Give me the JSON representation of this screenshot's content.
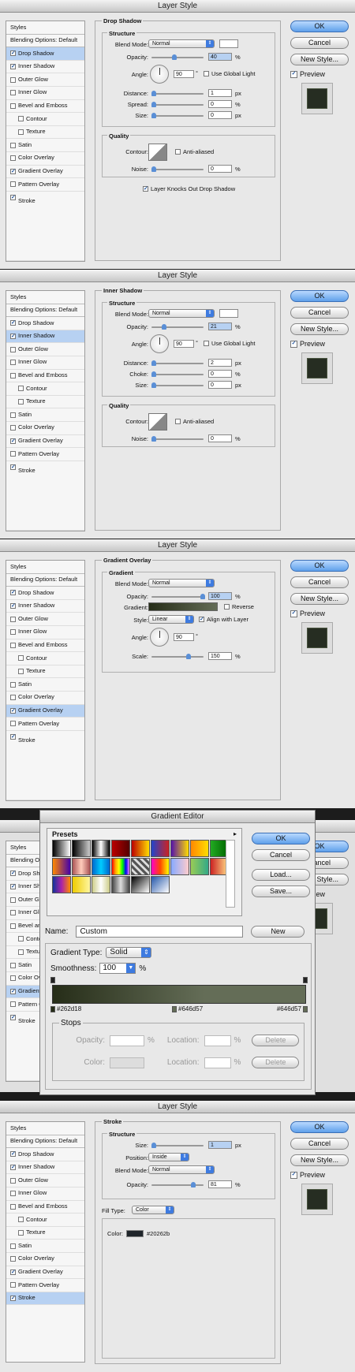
{
  "styles_list": [
    "Styles",
    "Blending Options: Default",
    "Drop Shadow",
    "Inner Shadow",
    "Outer Glow",
    "Inner Glow",
    "Bevel and Emboss",
    "Contour",
    "Texture",
    "Satin",
    "Color Overlay",
    "Gradient Overlay",
    "Pattern Overlay",
    "Stroke"
  ],
  "buttons": {
    "ok": "OK",
    "cancel": "Cancel",
    "new_style": "New Style...",
    "preview": "Preview"
  },
  "window_title": "Layer Style",
  "labels": {
    "blend_mode": "Blend Mode:",
    "opacity": "Opacity:",
    "angle": "Angle:",
    "use_global": "Use Global Light",
    "distance": "Distance:",
    "spread": "Spread:",
    "choke": "Choke:",
    "size": "Size:",
    "contour": "Contour:",
    "anti": "Anti-aliased",
    "noise": "Noise:",
    "px": "px",
    "pct": "%",
    "deg": "°",
    "knocks": "Layer Knocks Out Drop Shadow",
    "structure": "Structure",
    "quality": "Quality",
    "gradient": "Gradient",
    "gradient_label": "Gradient:",
    "reverse": "Reverse",
    "style": "Style:",
    "align": "Align with Layer",
    "scale": "Scale:",
    "position": "Position:",
    "fill_type": "Fill Type:",
    "color": "Color:"
  },
  "drop_shadow": {
    "title": "Drop Shadow",
    "blend": "Normal",
    "opacity": "40",
    "angle": "90",
    "distance": "1",
    "spread": "0",
    "size": "0",
    "noise": "0"
  },
  "inner_shadow": {
    "title": "Inner Shadow",
    "blend": "Normal",
    "opacity": "21",
    "angle": "90",
    "distance": "2",
    "choke": "0",
    "size": "0",
    "noise": "0"
  },
  "gradient_overlay": {
    "title": "Gradient Overlay",
    "blend": "Normal",
    "opacity": "100",
    "style": "Linear",
    "angle": "90",
    "scale": "150"
  },
  "gradient_editor": {
    "title": "Gradient Editor",
    "presets": "Presets",
    "ok": "OK",
    "cancel": "Cancel",
    "load": "Load...",
    "save": "Save...",
    "name_label": "Name:",
    "name": "Custom",
    "new": "New",
    "type_label": "Gradient Type:",
    "type": "Solid",
    "smooth_label": "Smoothness:",
    "smooth": "100",
    "pct": "%",
    "stop1": "#262d18",
    "stop2": "#646d57",
    "stop3": "#646d57",
    "stops": "Stops",
    "opacity": "Opacity:",
    "location": "Location:",
    "color": "Color:",
    "delete": "Delete"
  },
  "stroke": {
    "title": "Stroke",
    "size": "1",
    "position": "Inside",
    "blend": "Normal",
    "opacity": "81",
    "fill": "Color",
    "color_hex": "#20262b"
  }
}
